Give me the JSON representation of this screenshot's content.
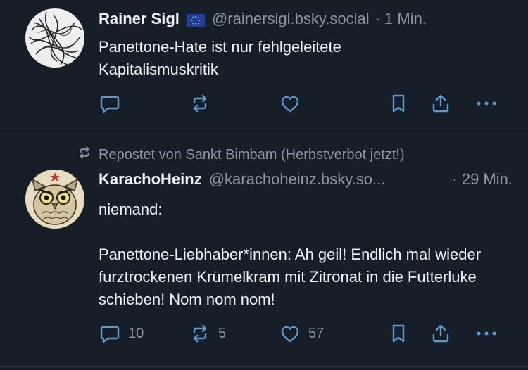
{
  "posts": [
    {
      "author": "Rainer Sigl",
      "flag_icon": "eu-flag-icon",
      "handle": "@rainersigl.bsky.social",
      "time": "· 1 Min.",
      "text": "Panettone-Hate ist nur fehlgeleitete\nKapitalismuskritik",
      "reply_count": "",
      "repost_count": "",
      "like_count": ""
    },
    {
      "repost_label": "Repostet von Sankt Bimbam (Herbstverbot jetzt!)",
      "author": "KarachoHeinz",
      "handle": "@karachoheinz.bsky.so...",
      "time": "· 29 Min.",
      "text": "niemand:\n\nPanettone-Liebhaber*innen: Ah geil! Endlich mal wieder furztrockenen Krümelkram mit Zitronat in die Futterluke schieben! Nom nom nom!",
      "reply_count": "10",
      "repost_count": "5",
      "like_count": "57"
    }
  ],
  "colors": {
    "background": "#161e27",
    "text": "#f1f3f5",
    "muted": "#8b98a5",
    "icon_blue": "#5b9bd1",
    "divider": "#2e3a47"
  },
  "icons": [
    "reply-icon",
    "repost-icon",
    "like-icon",
    "bookmark-icon",
    "share-icon",
    "more-icon"
  ]
}
